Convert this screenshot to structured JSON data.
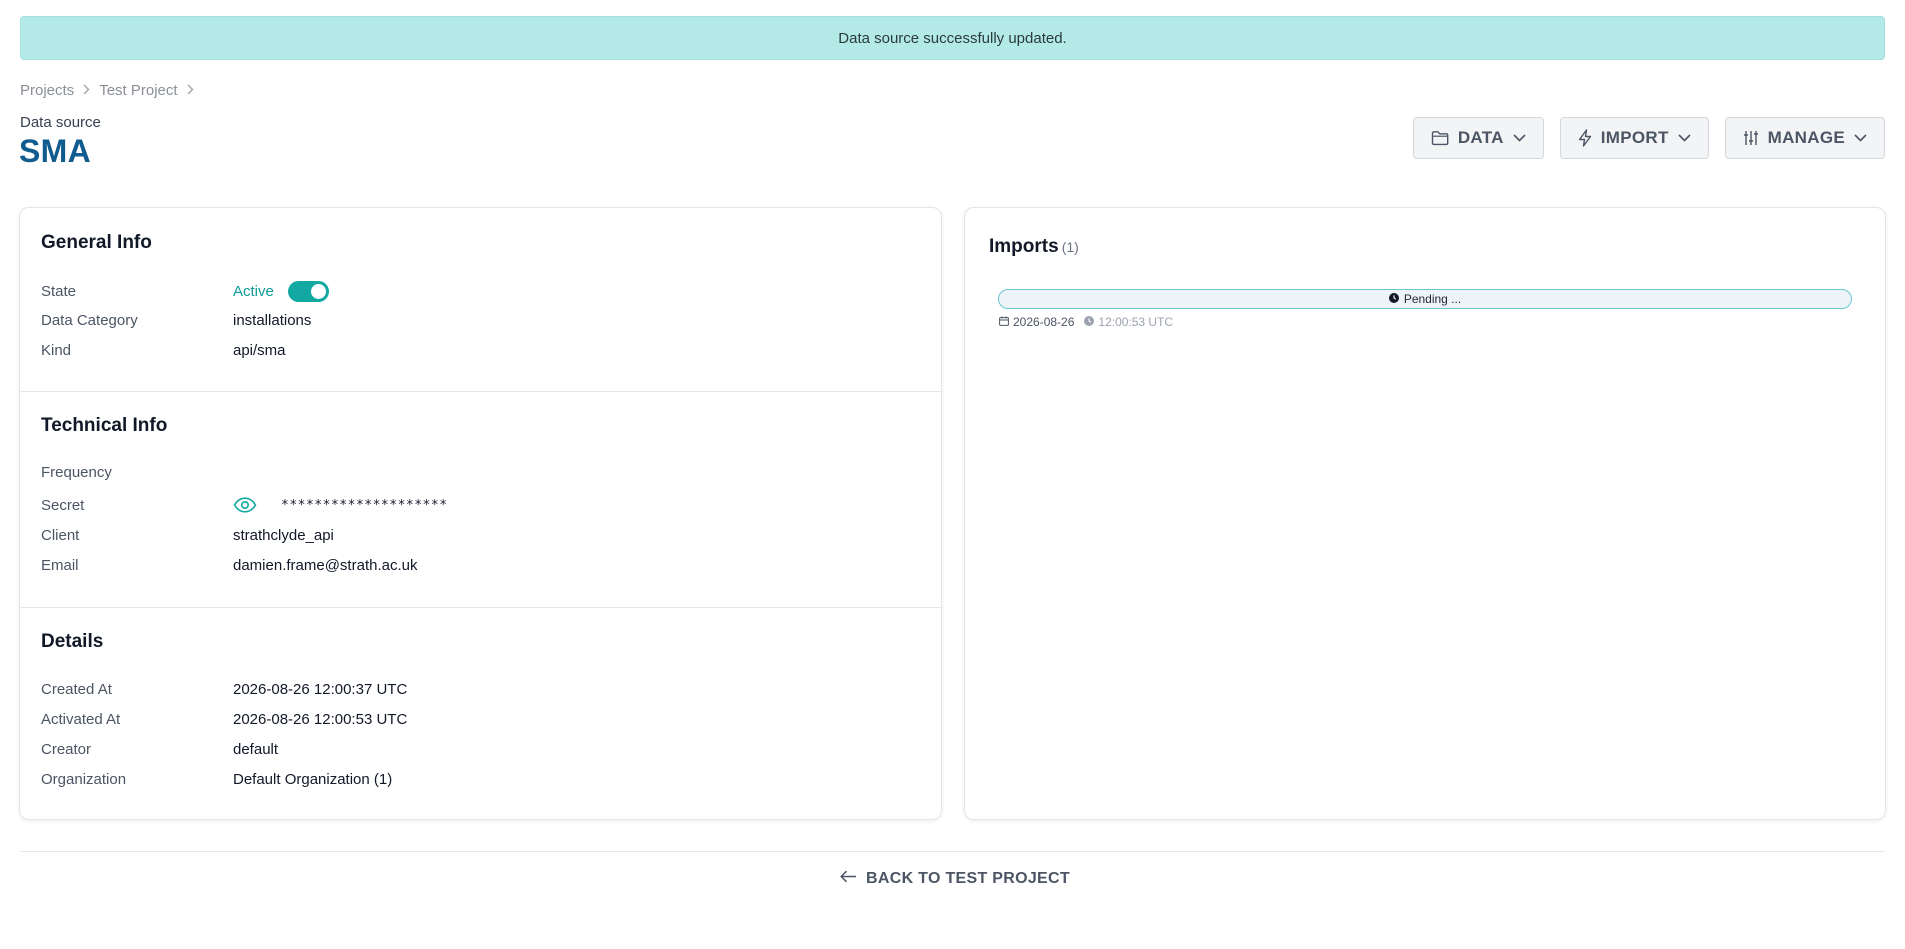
{
  "banner": {
    "message": "Data source successfully updated."
  },
  "breadcrumb": [
    {
      "label": "Projects"
    },
    {
      "label": "Test Project"
    }
  ],
  "header": {
    "eyebrow": "Data source",
    "title": "SMA",
    "actions": [
      {
        "label": "DATA",
        "icon": "folder-icon"
      },
      {
        "label": "IMPORT",
        "icon": "lightning-icon"
      },
      {
        "label": "MANAGE",
        "icon": "sliders-icon"
      }
    ]
  },
  "general_info": {
    "title": "General Info",
    "state_label": "State",
    "state_value": "Active",
    "state_enabled": true,
    "category_label": "Data Category",
    "category_value": "installations",
    "kind_label": "Kind",
    "kind_value": "api/sma"
  },
  "technical_info": {
    "title": "Technical Info",
    "frequency_label": "Frequency",
    "frequency_value": "",
    "secret_label": "Secret",
    "secret_value": "********************",
    "client_label": "Client",
    "client_value": "strathclyde_api",
    "email_label": "Email",
    "email_value": "damien.frame@strath.ac.uk"
  },
  "details": {
    "title": "Details",
    "created_label": "Created At",
    "created_value": "2026-08-26 12:00:37 UTC",
    "activated_label": "Activated At",
    "activated_value": "2026-08-26 12:00:53 UTC",
    "creator_label": "Creator",
    "creator_value": "default",
    "org_label": "Organization",
    "org_value": "Default Organization (1)"
  },
  "imports": {
    "title": "Imports",
    "count": "(1)",
    "items": [
      {
        "status": "Pending ...",
        "date": "2026-08-26",
        "time": "12:00:53 UTC"
      }
    ]
  },
  "footer": {
    "back_label": "BACK TO TEST PROJECT"
  },
  "colors": {
    "banner_bg": "#b3eae8",
    "title": "#115c8f",
    "accent": "#14a8a2"
  }
}
